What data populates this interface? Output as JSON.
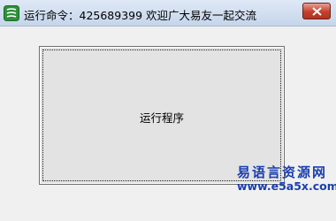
{
  "window": {
    "title": "运行命令：425689399 欢迎广大易友一起交流",
    "close_icon": "close-icon",
    "app_icon": "app-icon"
  },
  "main": {
    "run_button_label": "运行程序"
  },
  "watermark": {
    "site_name": "易语言资源网",
    "url": "www.e5a5x.com"
  },
  "colors": {
    "watermark": "#1a3fb0",
    "close_button": "#c4402c"
  }
}
